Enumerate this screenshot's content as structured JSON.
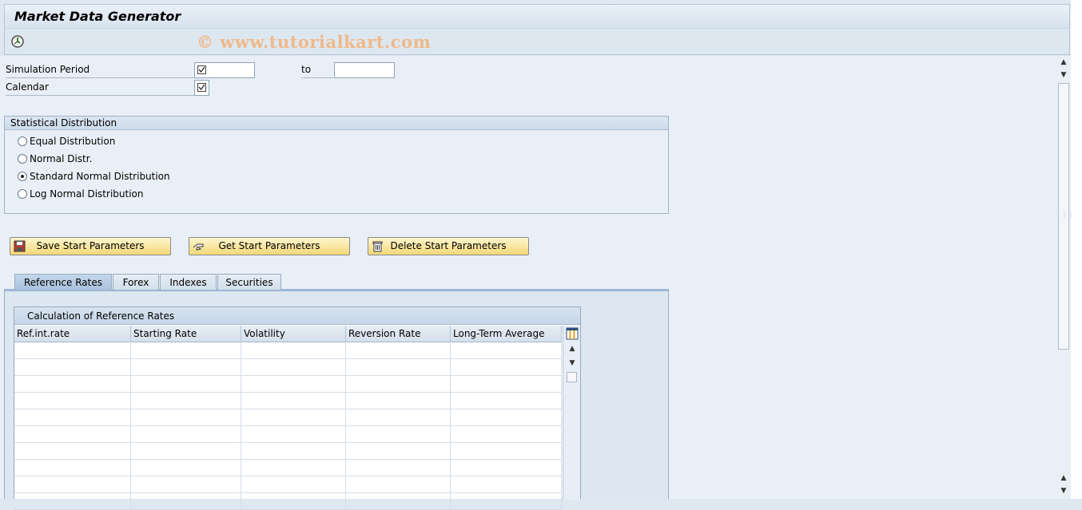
{
  "window": {
    "title": "Market Data Generator",
    "watermark": "© www.tutorialkart.com"
  },
  "toolbar": {
    "execute_icon": "execute-clock-icon"
  },
  "selection": {
    "simulation_period_label": "Simulation Period",
    "simulation_period_from": "",
    "to_label": "to",
    "simulation_period_to": "",
    "calendar_label": "Calendar",
    "calendar_value": ""
  },
  "distribution": {
    "title": "Statistical Distribution",
    "options": [
      {
        "label": "Equal Distribution",
        "selected": false
      },
      {
        "label": "Normal Distr.",
        "selected": false
      },
      {
        "label": "Standard Normal Distribution",
        "selected": true
      },
      {
        "label": "Log Normal Distribution",
        "selected": false
      }
    ]
  },
  "buttons": {
    "save": "Save Start Parameters",
    "get": "Get Start Parameters",
    "delete": "Delete Start Parameters"
  },
  "tabs": [
    {
      "label": "Reference Rates",
      "active": true
    },
    {
      "label": "Forex",
      "active": false
    },
    {
      "label": "Indexes",
      "active": false
    },
    {
      "label": "Securities",
      "active": false
    }
  ],
  "table": {
    "caption": "Calculation of Reference Rates",
    "columns": [
      "Ref.int.rate",
      "Starting Rate",
      "Volatility",
      "Reversion Rate",
      "Long-Term Average"
    ],
    "rows": []
  }
}
